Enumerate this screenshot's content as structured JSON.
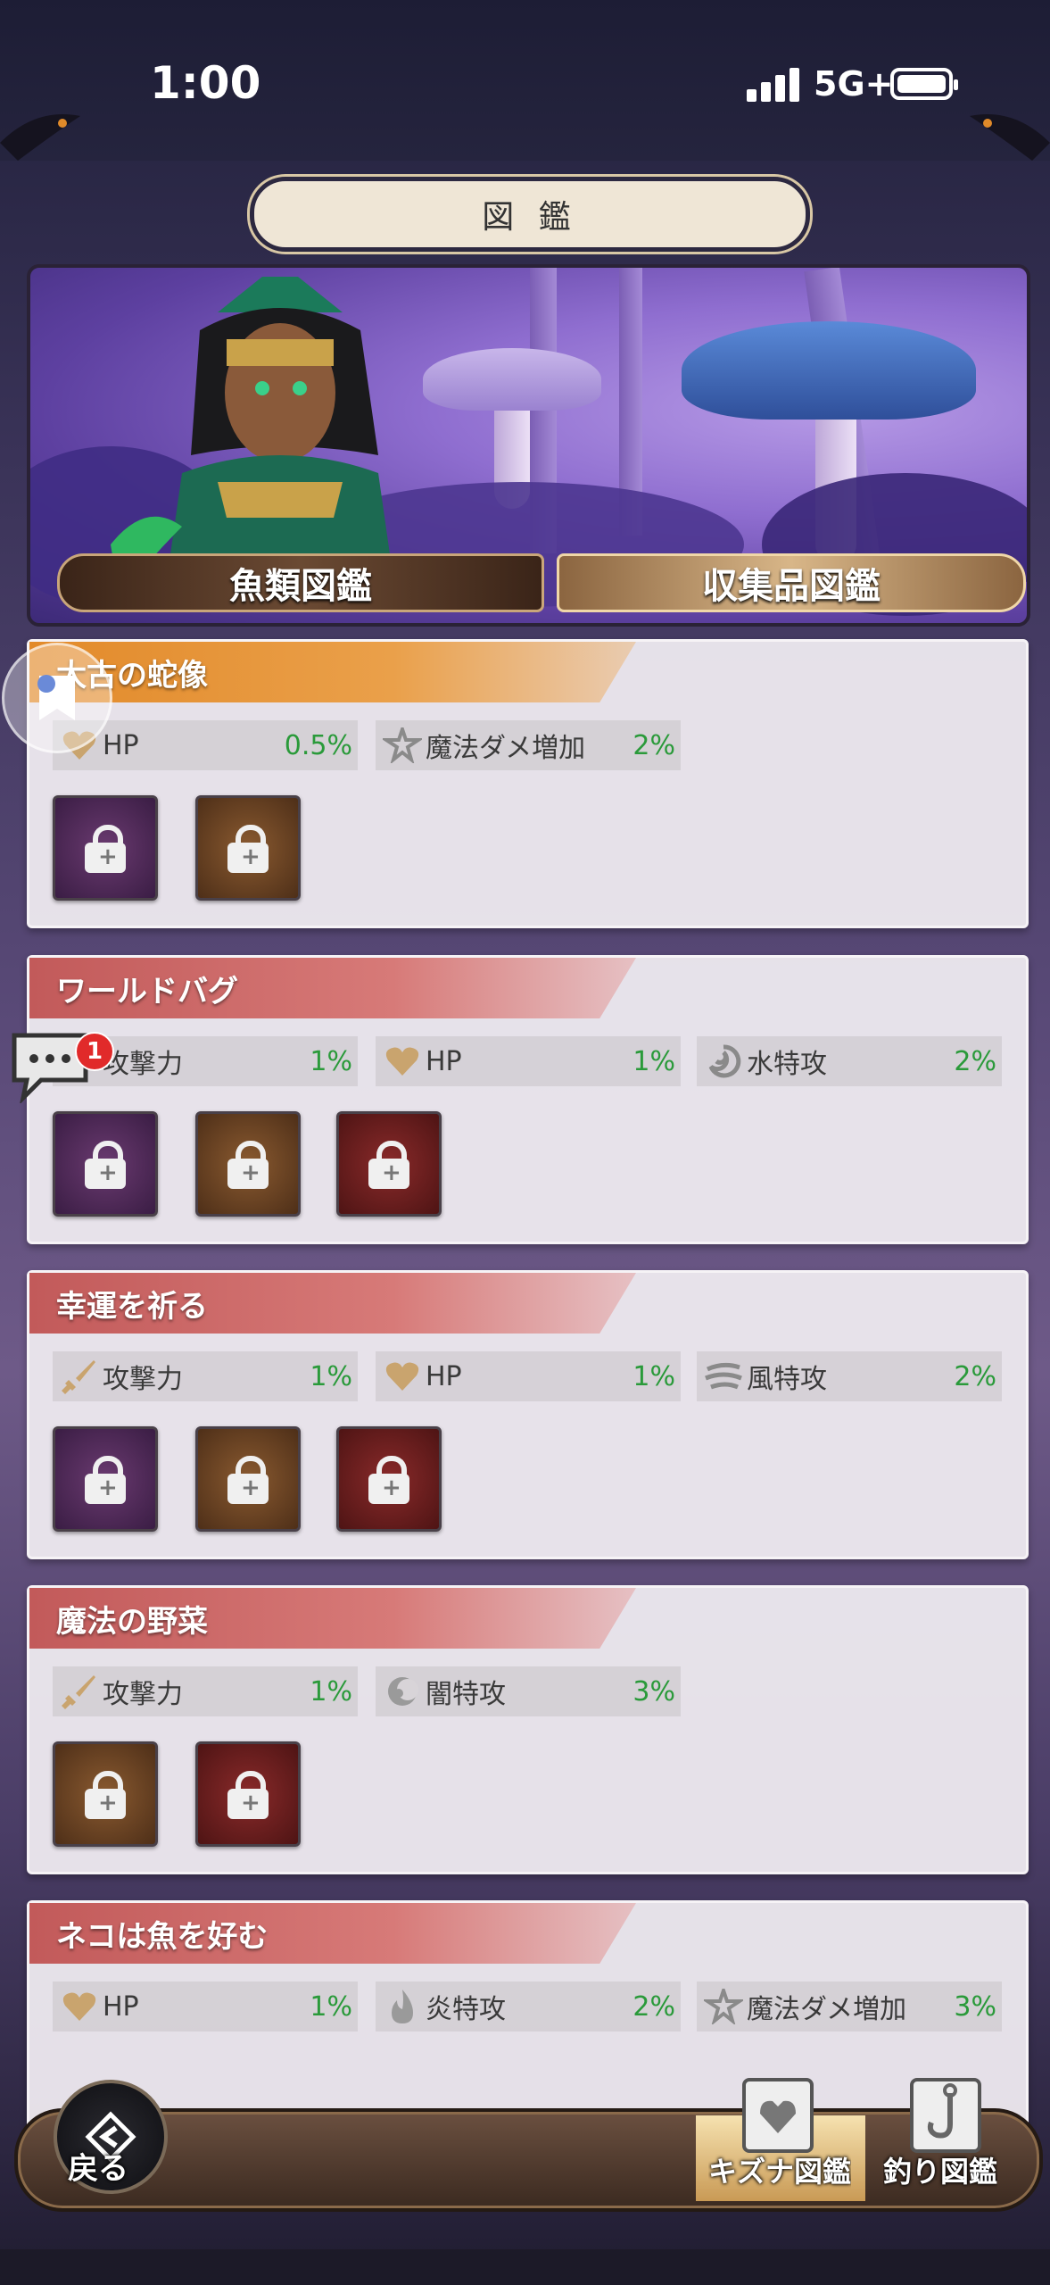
{
  "status_bar": {
    "time": "1:00",
    "network": "5G+"
  },
  "header": {
    "title": "図 鑑"
  },
  "banner_tabs": {
    "left": "魚類図鑑",
    "right": "収集品図鑑"
  },
  "cards": [
    {
      "title": "太古の蛇像",
      "color": "orange",
      "stats": [
        {
          "icon": "heart-icon",
          "name": "HP",
          "value": "0.5%"
        },
        {
          "icon": "magic-icon",
          "name": "魔法ダメ増加",
          "value": "2%"
        }
      ],
      "items": [
        "purple",
        "brown"
      ]
    },
    {
      "title": "ワールドバグ",
      "color": "red",
      "stats": [
        {
          "icon": "sword-icon",
          "name": "攻撃力",
          "value": "1%"
        },
        {
          "icon": "heart-icon",
          "name": "HP",
          "value": "1%"
        },
        {
          "icon": "water-icon",
          "name": "水特攻",
          "value": "2%"
        }
      ],
      "items": [
        "purple",
        "brown",
        "red"
      ]
    },
    {
      "title": "幸運を祈る",
      "color": "red",
      "stats": [
        {
          "icon": "sword-icon",
          "name": "攻撃力",
          "value": "1%"
        },
        {
          "icon": "heart-icon",
          "name": "HP",
          "value": "1%"
        },
        {
          "icon": "wind-icon",
          "name": "風特攻",
          "value": "2%"
        }
      ],
      "items": [
        "purple",
        "brown",
        "red"
      ]
    },
    {
      "title": "魔法の野菜",
      "color": "red",
      "stats": [
        {
          "icon": "sword-icon",
          "name": "攻撃力",
          "value": "1%"
        },
        {
          "icon": "dark-icon",
          "name": "闇特攻",
          "value": "3%"
        }
      ],
      "items": [
        "brown",
        "red"
      ]
    },
    {
      "title": "ネコは魚を好む",
      "color": "red",
      "stats": [
        {
          "icon": "heart-icon",
          "name": "HP",
          "value": "1%"
        },
        {
          "icon": "fire-icon",
          "name": "炎特攻",
          "value": "2%"
        },
        {
          "icon": "magic-icon",
          "name": "魔法ダメ増加",
          "value": "3%"
        }
      ],
      "items": []
    }
  ],
  "chat": {
    "badge_count": "1"
  },
  "bottom_nav": {
    "back_label": "戻る",
    "kizuna_label": "キズナ図鑑",
    "fishing_label": "釣り図鑑"
  },
  "colors": {
    "accent_orange": "#e28a2a",
    "accent_red": "#c25a5a",
    "stat_value_green": "#2a9a3a"
  }
}
